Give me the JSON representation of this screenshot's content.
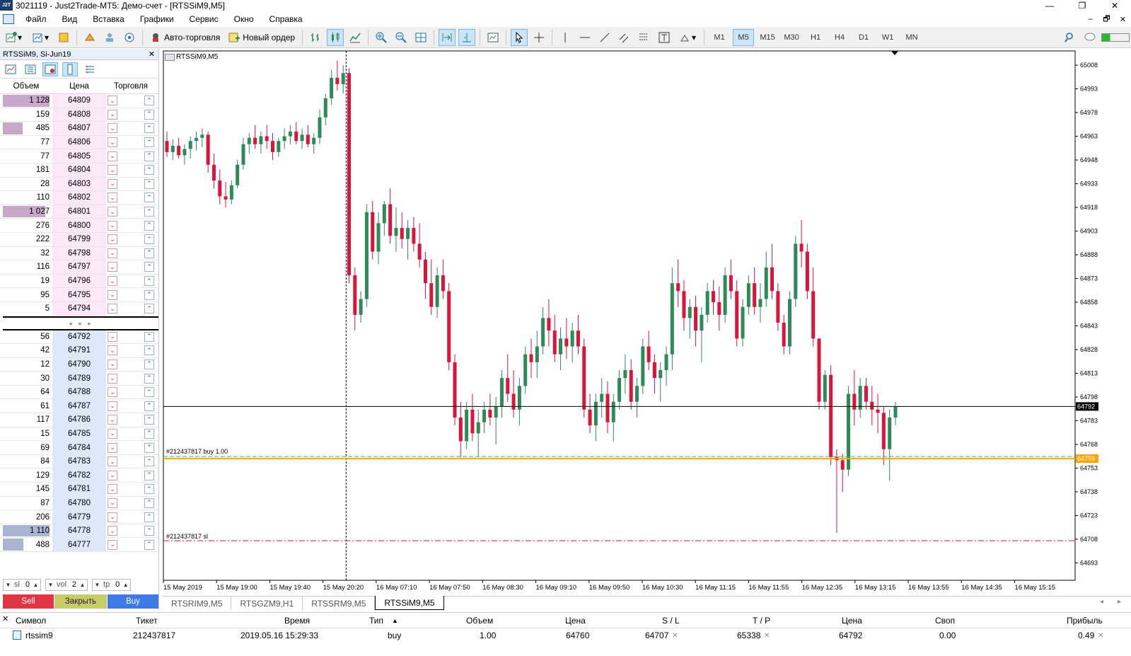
{
  "window": {
    "logo": "J2T",
    "title": "3021119 - Just2Trade-MT5: Демо-счет - [RTSSiM9,M5]"
  },
  "menu": [
    "Файл",
    "Вид",
    "Вставка",
    "Графики",
    "Сервис",
    "Окно",
    "Справка"
  ],
  "toolbar": {
    "autotrading": "Авто-торговля",
    "new_order": "Новый ордер",
    "timeframes": [
      "M1",
      "M5",
      "M15",
      "M30",
      "H1",
      "H4",
      "D1",
      "W1",
      "MN"
    ],
    "active_timeframe": "M5"
  },
  "market_watch": {
    "title": "RTSSiM9, Si-Jun19",
    "headers": {
      "volume": "Объем",
      "price": "Цена",
      "trade": "Торговля"
    },
    "asks": [
      {
        "vol": "1 128",
        "price": "64809",
        "share": 1.0
      },
      {
        "vol": "159",
        "price": "64808",
        "share": 0
      },
      {
        "vol": "485",
        "price": "64807",
        "share": 0.43
      },
      {
        "vol": "77",
        "price": "64806",
        "share": 0
      },
      {
        "vol": "77",
        "price": "64805",
        "share": 0
      },
      {
        "vol": "181",
        "price": "64804",
        "share": 0
      },
      {
        "vol": "28",
        "price": "64803",
        "share": 0
      },
      {
        "vol": "110",
        "price": "64802",
        "share": 0
      },
      {
        "vol": "1 027",
        "price": "64801",
        "share": 0.91
      },
      {
        "vol": "276",
        "price": "64800",
        "share": 0
      },
      {
        "vol": "222",
        "price": "64799",
        "share": 0
      },
      {
        "vol": "32",
        "price": "64798",
        "share": 0
      },
      {
        "vol": "116",
        "price": "64797",
        "share": 0
      },
      {
        "vol": "19",
        "price": "64796",
        "share": 0
      },
      {
        "vol": "95",
        "price": "64795",
        "share": 0
      },
      {
        "vol": "5",
        "price": "64794",
        "share": 0
      }
    ],
    "separator": "• • •",
    "bids": [
      {
        "vol": "56",
        "price": "64792",
        "share": 0
      },
      {
        "vol": "42",
        "price": "64791",
        "share": 0
      },
      {
        "vol": "12",
        "price": "64790",
        "share": 0
      },
      {
        "vol": "30",
        "price": "64789",
        "share": 0
      },
      {
        "vol": "64",
        "price": "64788",
        "share": 0
      },
      {
        "vol": "61",
        "price": "64787",
        "share": 0
      },
      {
        "vol": "117",
        "price": "64786",
        "share": 0
      },
      {
        "vol": "15",
        "price": "64785",
        "share": 0
      },
      {
        "vol": "69",
        "price": "64784",
        "share": 0
      },
      {
        "vol": "84",
        "price": "64783",
        "share": 0
      },
      {
        "vol": "129",
        "price": "64782",
        "share": 0
      },
      {
        "vol": "145",
        "price": "64781",
        "share": 0
      },
      {
        "vol": "87",
        "price": "64780",
        "share": 0
      },
      {
        "vol": "206",
        "price": "64779",
        "share": 0
      },
      {
        "vol": "1 110",
        "price": "64778",
        "share": 1.0
      },
      {
        "vol": "488",
        "price": "64777",
        "share": 0.44
      }
    ],
    "controls": {
      "sl_label": "sl",
      "sl_value": "0",
      "vol_label": "vol",
      "vol_value": "2",
      "tp_label": "tp",
      "tp_value": "0"
    },
    "buttons": {
      "sell": "Sell",
      "close": "Закрыть",
      "buy": "Buy"
    }
  },
  "chart": {
    "label": "RTSSiM9,M5",
    "bull_color": "#2e8b57",
    "bear_color": "#dc143c",
    "current_price": "64792",
    "order_price": "64759",
    "order_label": "#212437817 buy 1.00",
    "sl_label": "#212437817 sl",
    "price_ticks": [
      "65008",
      "64993",
      "64978",
      "64963",
      "64948",
      "64933",
      "64918",
      "64903",
      "64888",
      "64873",
      "64858",
      "64843",
      "64828",
      "64813",
      "64798",
      "64783",
      "64768",
      "64753",
      "64738",
      "64723",
      "64708",
      "64693"
    ],
    "time_ticks": [
      "15 May 2019",
      "15 May 19:00",
      "15 May 19:40",
      "15 May 20:20",
      "16 May 07:10",
      "16 May 07:50",
      "16 May 08:30",
      "16 May 09:10",
      "16 May 09:50",
      "16 May 10:30",
      "16 May 11:15",
      "16 May 11:55",
      "16 May 12:35",
      "16 May 13:15",
      "16 May 13:55",
      "16 May 14:35",
      "16 May 15:15"
    ]
  },
  "chart_tabs": [
    "RTSRIM9,M5",
    "RTSGZM9,H1",
    "RTSSRM9,M5",
    "RTSSiM9,M5"
  ],
  "active_chart_tab": "RTSSiM9,M5",
  "trade": {
    "headers": [
      "Символ",
      "Тикет",
      "Время",
      "Тип",
      "Объем",
      "Цена",
      "S / L",
      "T / P",
      "Цена",
      "Своп",
      "Прибыль"
    ],
    "row": {
      "symbol": "rtssim9",
      "ticket": "212437817",
      "time": "2019.05.16 15:29:33",
      "type": "buy",
      "volume": "1.00",
      "price": "64760",
      "sl": "64707",
      "tp": "65338",
      "current": "64792",
      "swap": "0.00",
      "profit": "0.49"
    }
  }
}
